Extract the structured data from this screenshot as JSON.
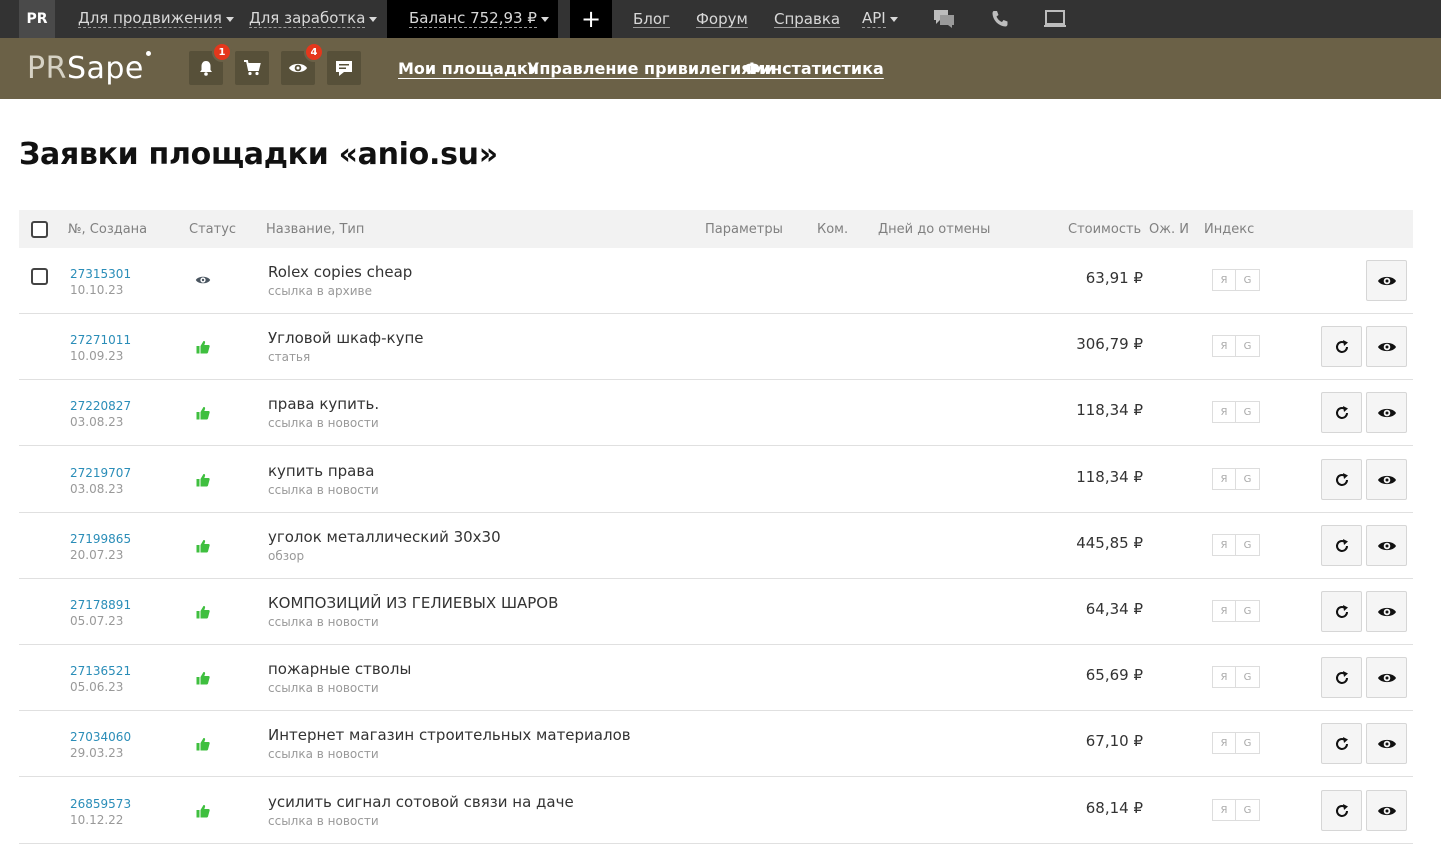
{
  "topbar": {
    "badge": "PR",
    "promo_label": "Для продвижения",
    "earn_label": "Для заработка",
    "balance_label": "Баланс 752,93 ₽",
    "plus_label": "+",
    "blog_label": "Блог",
    "forum_label": "Форум",
    "help_label": "Справка",
    "api_label": "API"
  },
  "header": {
    "logo_pr": "PR",
    "logo_sape": "Sape",
    "notifications_count": "1",
    "watch_count": "4",
    "nav": [
      "Мои площадки",
      "Управление привилегиями",
      "Финстатистика"
    ]
  },
  "page": {
    "title": "Заявки площадки «anio.su»"
  },
  "table": {
    "headers": {
      "number": "№, Создана",
      "status": "Статус",
      "name": "Название, Тип",
      "params": "Параметры",
      "com": "Ком.",
      "days": "Дней до отмены",
      "cost": "Стоимость",
      "wait": "Ож. И",
      "index": "Индекс"
    },
    "index_labels": {
      "ya": "Я",
      "g": "G"
    },
    "rows": [
      {
        "num": "27315301",
        "date": "10.10.23",
        "status": "watch",
        "name": "Rolex copies cheap",
        "type": "ссылка в архиве",
        "price": "63,91 ₽",
        "has_checkbox": true,
        "has_refresh": false
      },
      {
        "num": "27271011",
        "date": "10.09.23",
        "status": "approved",
        "name": "Угловой шкаф-купе",
        "type": "статья",
        "price": "306,79 ₽",
        "has_checkbox": false,
        "has_refresh": true
      },
      {
        "num": "27220827",
        "date": "03.08.23",
        "status": "approved",
        "name": "права купить.",
        "type": "ссылка в новости",
        "price": "118,34 ₽",
        "has_checkbox": false,
        "has_refresh": true
      },
      {
        "num": "27219707",
        "date": "03.08.23",
        "status": "approved",
        "name": "купить права",
        "type": "ссылка в новости",
        "price": "118,34 ₽",
        "has_checkbox": false,
        "has_refresh": true
      },
      {
        "num": "27199865",
        "date": "20.07.23",
        "status": "approved",
        "name": "уголок металлический 30х30",
        "type": "обзор",
        "price": "445,85 ₽",
        "has_checkbox": false,
        "has_refresh": true
      },
      {
        "num": "27178891",
        "date": "05.07.23",
        "status": "approved",
        "name": "КОМПОЗИЦИЙ ИЗ ГЕЛИЕВЫХ ШАРОВ",
        "type": "ссылка в новости",
        "price": "64,34 ₽",
        "has_checkbox": false,
        "has_refresh": true
      },
      {
        "num": "27136521",
        "date": "05.06.23",
        "status": "approved",
        "name": "пожарные стволы",
        "type": "ссылка в новости",
        "price": "65,69 ₽",
        "has_checkbox": false,
        "has_refresh": true
      },
      {
        "num": "27034060",
        "date": "29.03.23",
        "status": "approved",
        "name": "Интернет магазин строительных материалов",
        "type": "ссылка в новости",
        "price": "67,10 ₽",
        "has_checkbox": false,
        "has_refresh": true
      },
      {
        "num": "26859573",
        "date": "10.12.22",
        "status": "approved",
        "name": "усилить сигнал сотовой связи на даче",
        "type": "ссылка в новости",
        "price": "68,14 ₽",
        "has_checkbox": false,
        "has_refresh": true
      }
    ]
  },
  "colors": {
    "topbar": "#333333",
    "header": "#6b6147",
    "link": "#2a8db8",
    "approved": "#3fbf3f",
    "badge": "#e4371c"
  }
}
